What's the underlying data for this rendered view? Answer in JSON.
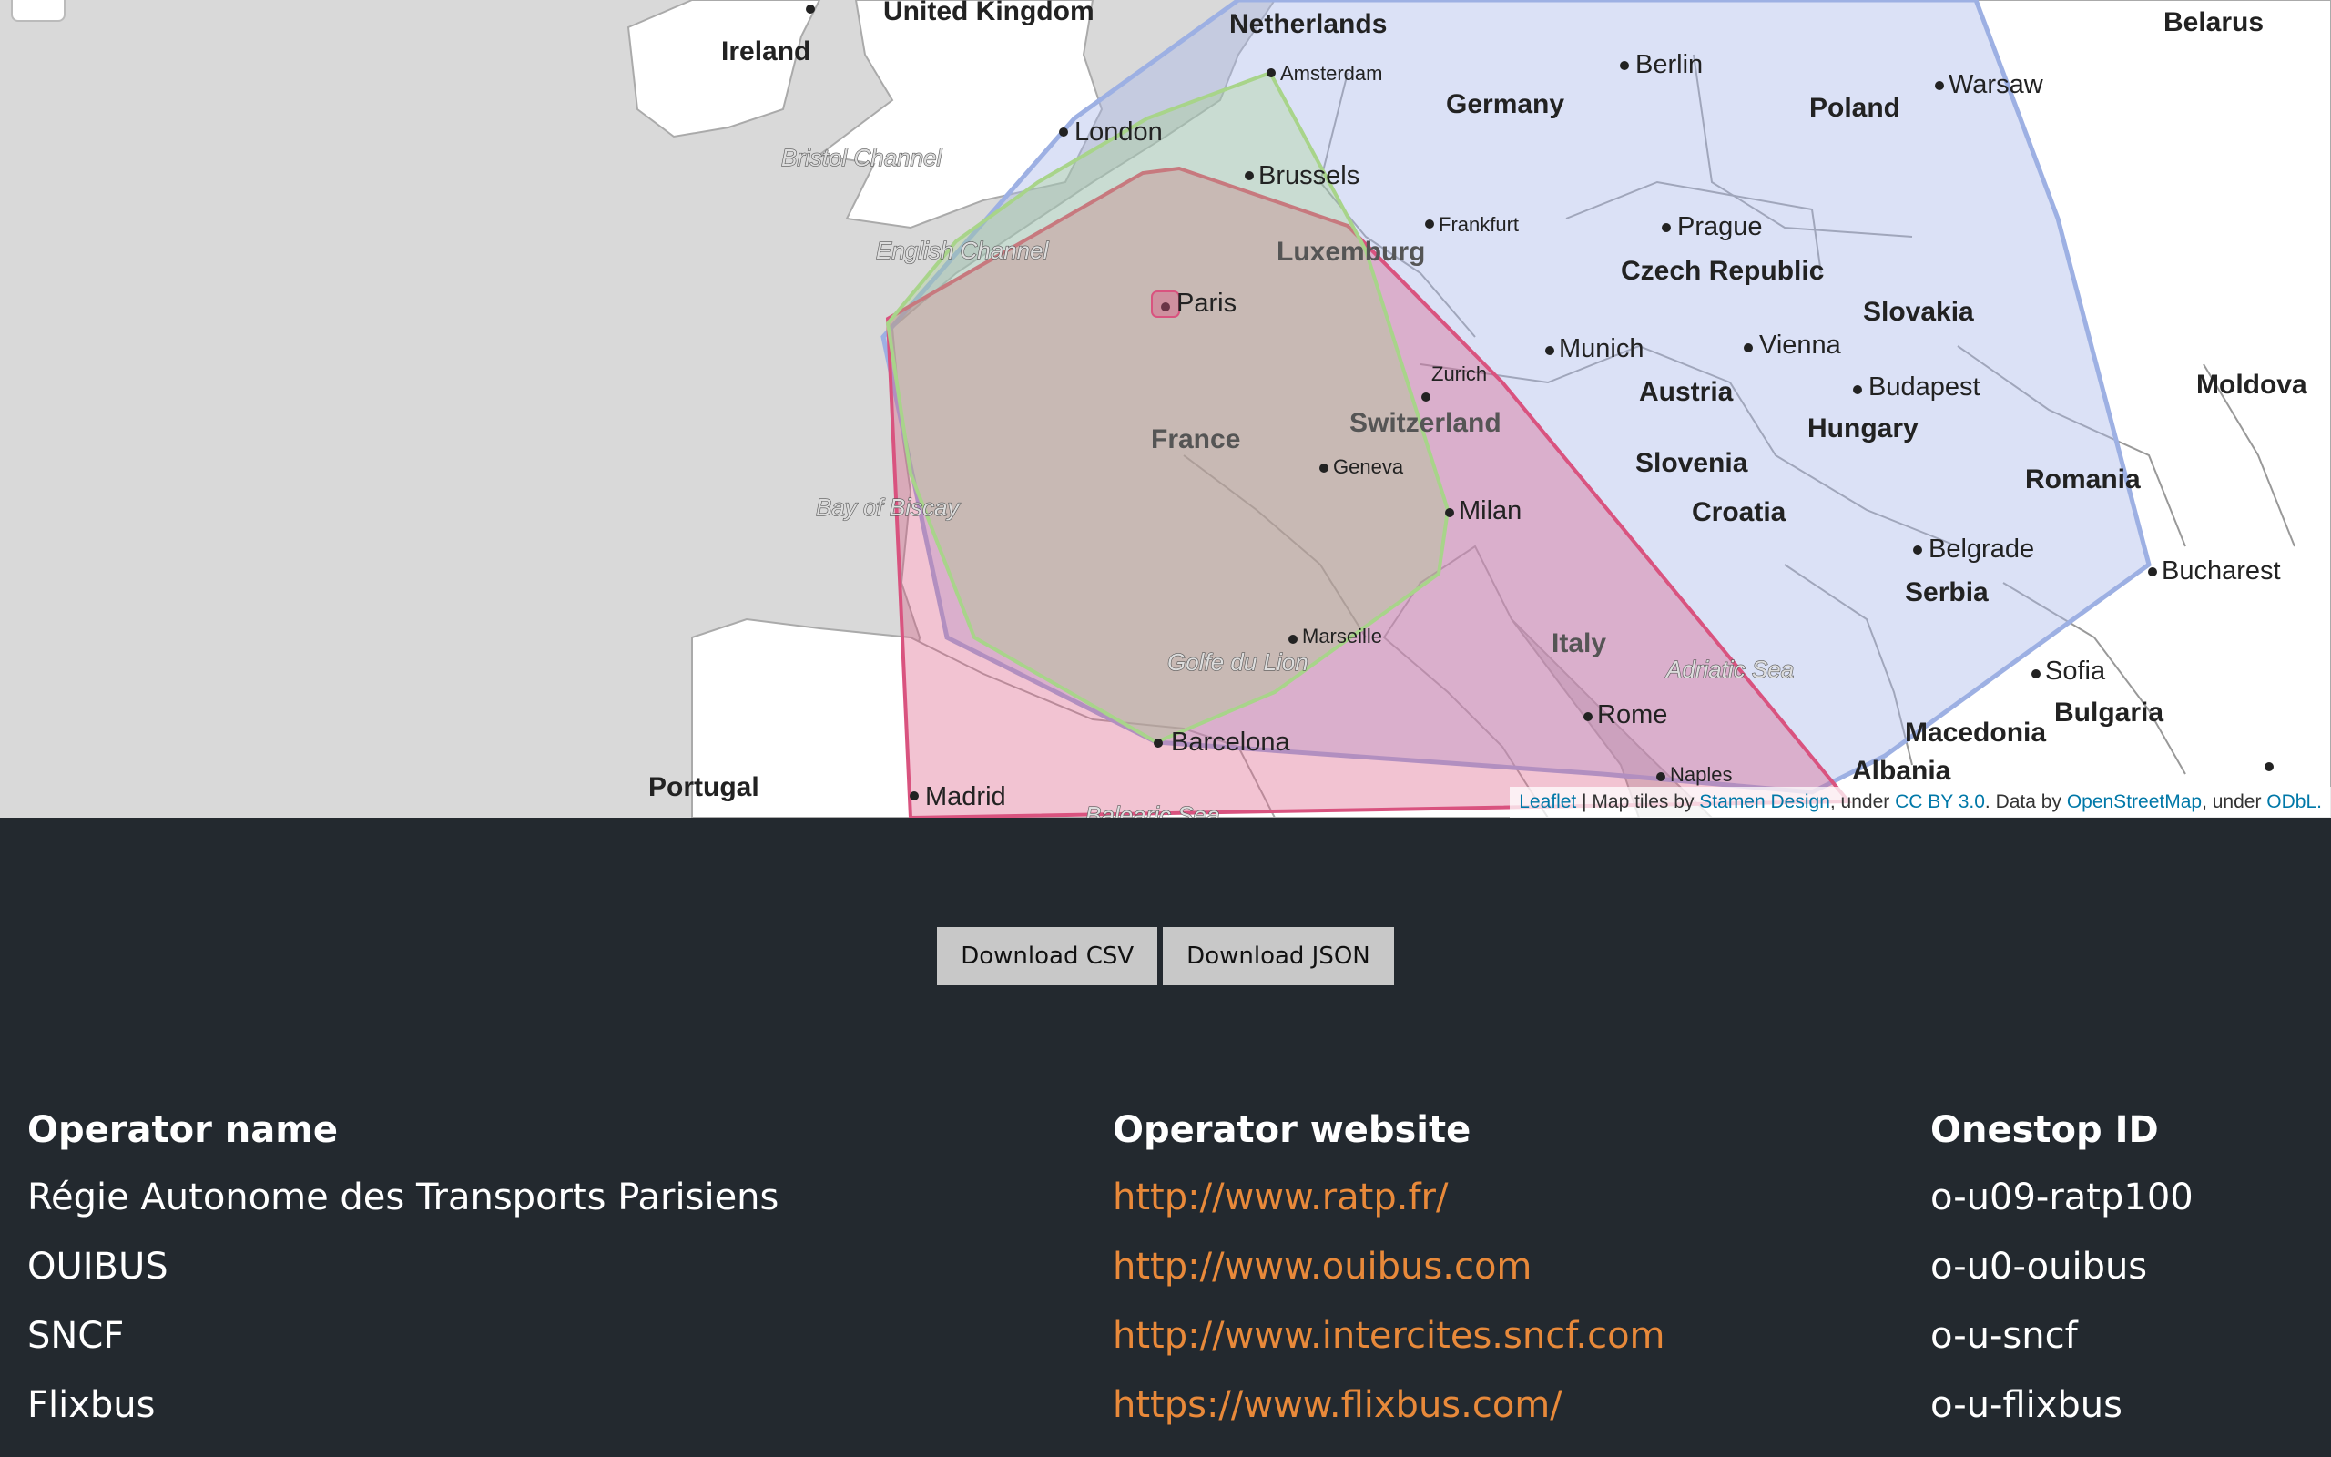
{
  "map": {
    "countries": [
      "Ireland",
      "United Kingdom",
      "Netherlands",
      "Germany",
      "Poland",
      "Belarus",
      "Czech Republic",
      "Slovakia",
      "Austria",
      "Hungary",
      "Moldova",
      "Romania",
      "Slovenia",
      "Croatia",
      "Serbia",
      "Luxemburg",
      "Switzerland",
      "France",
      "Italy",
      "Bulgaria",
      "Macedonia",
      "Albania",
      "Portugal"
    ],
    "cities": [
      "London",
      "Amsterdam",
      "Brussels",
      "Berlin",
      "Warsaw",
      "Frankfurt",
      "Prague",
      "Paris",
      "Munich",
      "Vienna",
      "Zurich",
      "Budapest",
      "Geneva",
      "Milan",
      "Belgrade",
      "Bucharest",
      "Marseille",
      "Rome",
      "Sofia",
      "Barcelona",
      "Naples",
      "Madrid"
    ],
    "seas": [
      "Bristol Channel",
      "English Channel",
      "Bay of Biscay",
      "Golfe du Lion",
      "Adriatic Sea",
      "Balearic Sea"
    ],
    "region_colors": {
      "blue": "#a9b8ea",
      "pink": "#d9537f",
      "green": "#9ed27e"
    }
  },
  "attribution": {
    "leaflet": "Leaflet",
    "text1": " | Map tiles by ",
    "stamen": "Stamen Design",
    "text2": ", under ",
    "ccby": "CC BY 3.0",
    "text3": ". Data by ",
    "osm": "OpenStreetMap",
    "text4": ", under ",
    "odbl": "ODbL."
  },
  "buttons": {
    "csv": "Download CSV",
    "json": "Download JSON"
  },
  "table": {
    "headers": [
      "Operator name",
      "Operator website",
      "Onestop ID"
    ],
    "rows": [
      {
        "name": "Régie Autonome des Transports Parisiens",
        "website": "http://www.ratp.fr/",
        "id": "o-u09-ratp100"
      },
      {
        "name": "OUIBUS",
        "website": "http://www.ouibus.com",
        "id": "o-u0-ouibus"
      },
      {
        "name": "SNCF",
        "website": "http://www.intercites.sncf.com",
        "id": "o-u-sncf"
      },
      {
        "name": "Flixbus",
        "website": "https://www.flixbus.com/",
        "id": "o-u-flixbus"
      }
    ]
  }
}
